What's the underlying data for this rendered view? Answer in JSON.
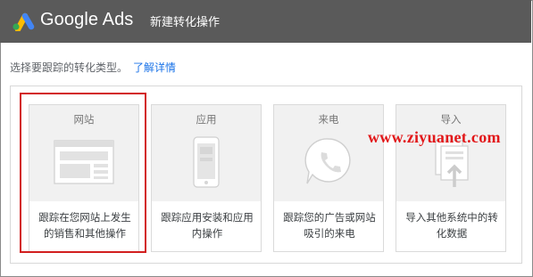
{
  "header": {
    "brand": "Google Ads",
    "title": "新建转化操作"
  },
  "intro": {
    "text": "选择要跟踪的转化类型。",
    "link": "了解详情"
  },
  "cards": [
    {
      "title": "网站",
      "desc": "跟踪在您网站上发生的销售和其他操作",
      "icon": "browser-window-icon",
      "selected": true
    },
    {
      "title": "应用",
      "desc": "跟踪应用安装和应用内操作",
      "icon": "mobile-phone-icon",
      "selected": false
    },
    {
      "title": "来电",
      "desc": "跟踪您的广告或网站吸引的来电",
      "icon": "phone-call-icon",
      "selected": false
    },
    {
      "title": "导入",
      "desc": "导入其他系统中的转化数据",
      "icon": "import-file-icon",
      "selected": false
    }
  ],
  "watermark": "www.ziyuanet.com",
  "colors": {
    "header_bg": "#5a5a5a",
    "selection_border": "#d21f1f",
    "link": "#1a73e8",
    "watermark": "#e2181a"
  }
}
